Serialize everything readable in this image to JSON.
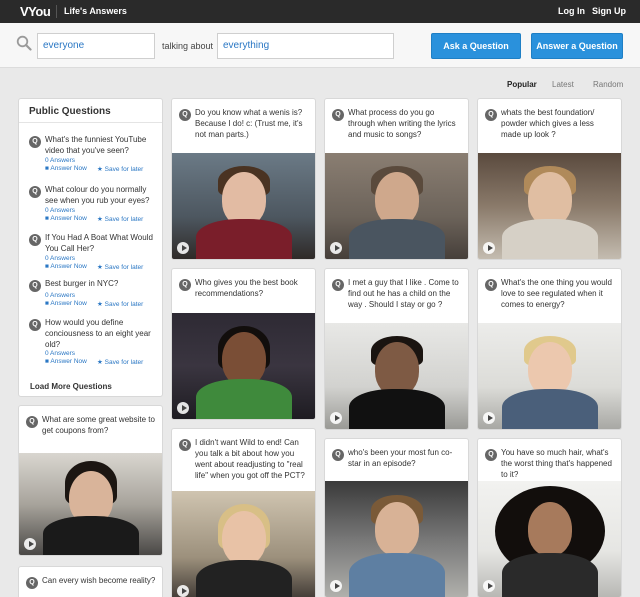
{
  "header": {
    "logo_text": "VYou",
    "tagline": "Life's Answers",
    "login": "Log In",
    "signup": "Sign Up"
  },
  "search": {
    "who_value": "everyone",
    "connector": "talking about",
    "topic_value": "everything",
    "ask_button": "Ask a Question",
    "answer_button": "Answer a Question"
  },
  "sort": {
    "popular": "Popular",
    "latest": "Latest",
    "random": "Random",
    "active": "Popular"
  },
  "sidebar": {
    "title": "Public Questions",
    "items": [
      {
        "text": "What's the funniest YouTube video that you've seen?",
        "answers": "0 Answers",
        "answer_now": "Answer Now",
        "save": "Save for later"
      },
      {
        "text": "What colour do you normally see when you rub your eyes?",
        "answers": "0 Answers",
        "answer_now": "Answer Now",
        "save": "Save for later"
      },
      {
        "text": "If You Had A Boat What Would You Call Her?",
        "answers": "0 Answers",
        "answer_now": "Answer Now",
        "save": "Save for later"
      },
      {
        "text": "Best burger in NYC?",
        "answers": "0 Answers",
        "answer_now": "Answer Now",
        "save": "Save for later"
      },
      {
        "text": "How would you define conciousness to an eight year old?",
        "answers": "0 Answers",
        "answer_now": "Answer Now",
        "save": "Save for later"
      }
    ],
    "load_more": "Load More Questions"
  },
  "q_icon": "Q",
  "cards": [
    {
      "question": "What are some great website to get coupons from?"
    },
    {
      "question": "Can every wish become reality?"
    },
    {
      "question": "Do you know what a wenis is? Because I do! c: (Trust me, it's not man parts.)"
    },
    {
      "question": "Who gives you the best book recommendations?"
    },
    {
      "question": "I didn't want Wild to end! Can you talk a bit about how you went about readjusting to \"real life\" when you got off the PCT?"
    },
    {
      "question": "What process do you go through when writing the lyrics and music to songs?"
    },
    {
      "question": "I met a guy that I like . Come to find out he has a child on the way . Should I stay or go ?"
    },
    {
      "question": "who's been your most fun co-star in an episode?"
    },
    {
      "question": "whats the best foundation/ powder which gives a less made up look ?"
    },
    {
      "question": "What's the one thing you would love to see regulated when it comes to energy?"
    },
    {
      "question": "You have so much hair, what's the worst thing that's happened to it?"
    }
  ],
  "colors": {
    "accent": "#2a91dc",
    "link": "#2a77c4",
    "topbar": "#2a2a2a",
    "background": "#e9e9e9"
  },
  "icons": {
    "search": "magnifier-icon",
    "video": "video-camera-icon",
    "save": "star-icon",
    "play": "play-icon",
    "question": "q-badge-icon"
  }
}
